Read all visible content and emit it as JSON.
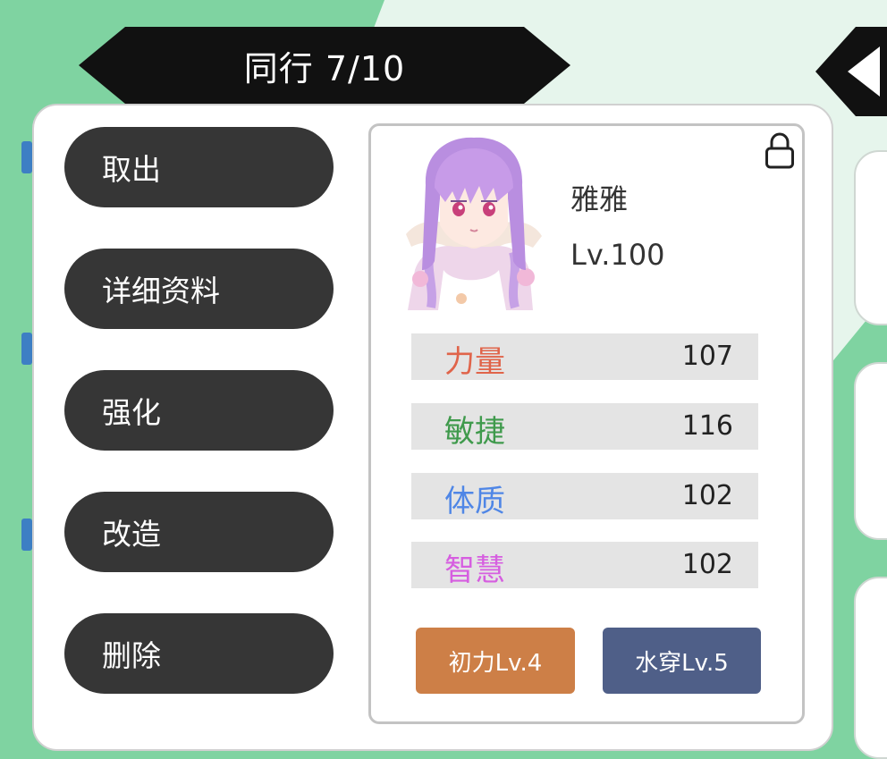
{
  "header": {
    "title": "同行 7/10"
  },
  "menu": {
    "items": [
      {
        "label": "取出"
      },
      {
        "label": "详细资料"
      },
      {
        "label": "强化"
      },
      {
        "label": "改造"
      },
      {
        "label": "删除"
      }
    ]
  },
  "character": {
    "name": "雅雅",
    "level": "Lv.100",
    "locked": true,
    "stats": [
      {
        "label": "力量",
        "value": "107",
        "color": "#e0644a"
      },
      {
        "label": "敏捷",
        "value": "116",
        "color": "#3f9a4c"
      },
      {
        "label": "体质",
        "value": "102",
        "color": "#4f86e6"
      },
      {
        "label": "智慧",
        "value": "102",
        "color": "#d65ee0"
      }
    ],
    "skills": [
      {
        "label": "初力Lv.4",
        "color": "#cd7f47"
      },
      {
        "label": "水穿Lv.5",
        "color": "#4f5f88"
      }
    ]
  },
  "colors": {
    "background_dark": "#7fd3a1",
    "background_light": "#e6f5ec",
    "button": "#363636",
    "banner": "#111111"
  },
  "icons": [
    "lock-icon",
    "chevron-left-icon"
  ]
}
